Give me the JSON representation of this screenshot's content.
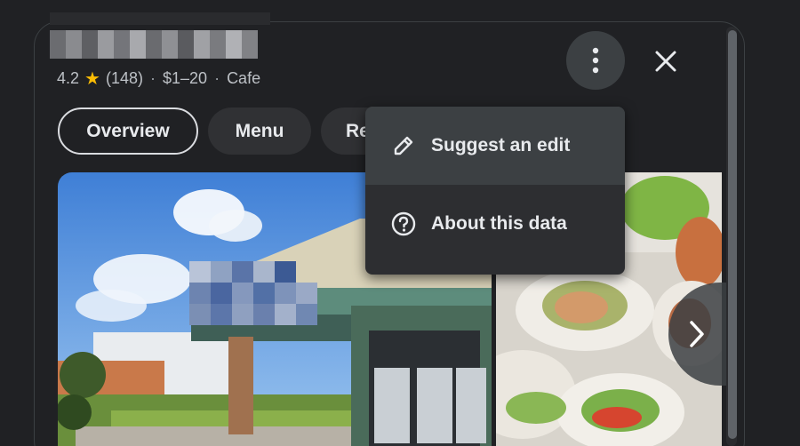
{
  "place": {
    "rating": "4.2",
    "reviews": "(148)",
    "price": "$1–20",
    "category": "Cafe"
  },
  "tabs": [
    {
      "label": "Overview",
      "active": true
    },
    {
      "label": "Menu",
      "active": false
    },
    {
      "label": "Re",
      "active": false
    }
  ],
  "menu": {
    "items": [
      {
        "label": "Suggest an edit",
        "icon": "pencil-icon",
        "hovered": true
      },
      {
        "label": "About this data",
        "icon": "help-circle-icon",
        "hovered": false
      }
    ]
  },
  "icons": {
    "more": "more-vert-icon",
    "close": "close-icon",
    "next": "chevron-right-icon",
    "rating": "star-icon"
  },
  "colors": {
    "background": "#202124",
    "star": "#fbbc04",
    "menu_bg": "#2d2e31",
    "menu_hover": "#3c4043"
  }
}
